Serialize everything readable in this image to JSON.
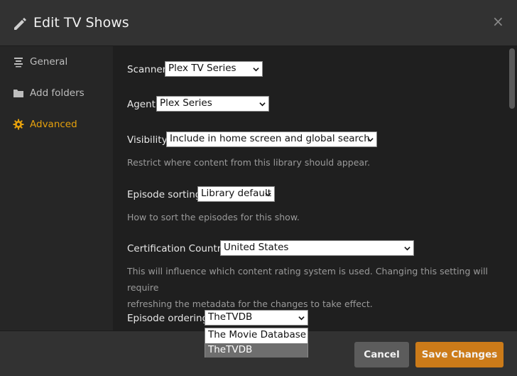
{
  "header": {
    "title": "Edit TV Shows",
    "close_label": "×",
    "icon": "pencil-icon"
  },
  "sidebar": {
    "items": [
      {
        "label": "General",
        "icon": "list-icon",
        "active": false
      },
      {
        "label": "Add folders",
        "icon": "folder-icon",
        "active": false
      },
      {
        "label": "Advanced",
        "icon": "gear-icon",
        "active": true
      }
    ]
  },
  "settings": {
    "scanner": {
      "label": "Scanner",
      "value": "Plex TV Series"
    },
    "agent": {
      "label": "Agent",
      "value": "Plex Series"
    },
    "visibility": {
      "label": "Visibility",
      "value": "Include in home screen and global search",
      "help": "Restrict where content from this library should appear."
    },
    "episode_sorting": {
      "label": "Episode sorting",
      "value": "Library default",
      "help": "How to sort the episodes for this show."
    },
    "certification_country": {
      "label": "Certification Country",
      "value": "United States",
      "help_line1": "This will influence which content rating system is used. Changing this setting will require",
      "help_line2": "refreshing the metadata for the changes to take effect."
    },
    "episode_ordering": {
      "label": "Episode ordering",
      "value": "TheTVDB",
      "options": [
        "The Movie Database",
        "TheTVDB"
      ],
      "highlighted": "TheTVDB"
    }
  },
  "footer": {
    "cancel_label": "Cancel",
    "save_label": "Save Changes"
  },
  "colors": {
    "accent": "#e5a00d",
    "save_button": "#cc7b19",
    "cancel_button": "#5c5c5c"
  }
}
